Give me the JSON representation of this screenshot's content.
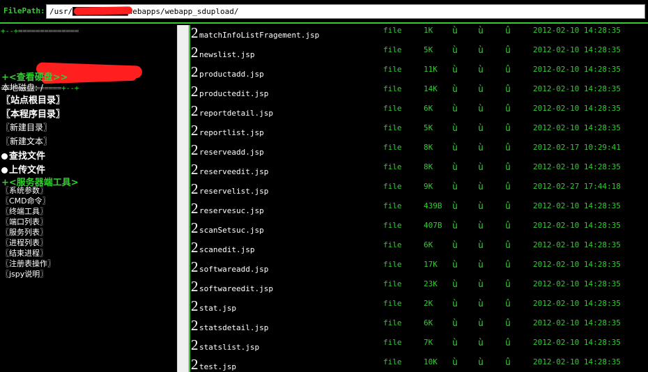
{
  "filepath": {
    "label": "FilePath:",
    "value": "/usr/████████████webapps/webapp_sdupload/"
  },
  "sidebar": {
    "sep_top": "+--+==============",
    "sep_bottom": "==============+--+",
    "disk_header": "+<查看硬盘>>",
    "local_disk": "本地磁盘: /",
    "site_root": "〖站点根目录〗",
    "program_dir": "〖本程序目录〗",
    "new_dir": "〖新建目录〗",
    "new_text": "〖新建文本〗",
    "find_file": "查找文件",
    "upload_file": "上传文件",
    "server_tools_header": "+<服务器端工具>",
    "tools": [
      "〖系统参数〗",
      "〖CMD命令〗",
      "〖终端工具〗",
      "〖端口列表〗",
      "〖服务列表〗",
      "〖进程列表〗",
      "〖结束进程〗",
      "〖注册表操作〗",
      "〖jspy说明〗"
    ]
  },
  "files": [
    {
      "name": "matchInfoListFragement.jsp",
      "type": "file",
      "size": "1K",
      "date": "2012-02-10 14:28:35"
    },
    {
      "name": "newslist.jsp",
      "type": "file",
      "size": "5K",
      "date": "2012-02-10 14:28:35"
    },
    {
      "name": "productadd.jsp",
      "type": "file",
      "size": "11K",
      "date": "2012-02-10 14:28:35"
    },
    {
      "name": "productedit.jsp",
      "type": "file",
      "size": "14K",
      "date": "2012-02-10 14:28:35"
    },
    {
      "name": "reportdetail.jsp",
      "type": "file",
      "size": "6K",
      "date": "2012-02-10 14:28:35"
    },
    {
      "name": "reportlist.jsp",
      "type": "file",
      "size": "5K",
      "date": "2012-02-10 14:28:35"
    },
    {
      "name": "reserveadd.jsp",
      "type": "file",
      "size": "8K",
      "date": "2012-02-17 10:29:41"
    },
    {
      "name": "reserveedit.jsp",
      "type": "file",
      "size": "8K",
      "date": "2012-02-10 14:28:35"
    },
    {
      "name": "reservelist.jsp",
      "type": "file",
      "size": "9K",
      "date": "2012-02-27 17:44:18"
    },
    {
      "name": "reservesuc.jsp",
      "type": "file",
      "size": "439B",
      "date": "2012-02-10 14:28:35"
    },
    {
      "name": "scanSetsuc.jsp",
      "type": "file",
      "size": "407B",
      "date": "2012-02-10 14:28:35"
    },
    {
      "name": "scanedit.jsp",
      "type": "file",
      "size": "6K",
      "date": "2012-02-10 14:28:35"
    },
    {
      "name": "softwareadd.jsp",
      "type": "file",
      "size": "17K",
      "date": "2012-02-10 14:28:35"
    },
    {
      "name": "softwareedit.jsp",
      "type": "file",
      "size": "23K",
      "date": "2012-02-10 14:28:35"
    },
    {
      "name": "stat.jsp",
      "type": "file",
      "size": "2K",
      "date": "2012-02-10 14:28:35"
    },
    {
      "name": "statsdetail.jsp",
      "type": "file",
      "size": "6K",
      "date": "2012-02-10 14:28:35"
    },
    {
      "name": "statslist.jsp",
      "type": "file",
      "size": "7K",
      "date": "2012-02-10 14:28:35"
    },
    {
      "name": "test.jsp",
      "type": "file",
      "size": "10K",
      "date": "2012-02-10 14:28:35"
    }
  ],
  "row_glyphs": {
    "marker": "2",
    "icon1": "ù",
    "icon2": "ù",
    "icon3": "û"
  },
  "colors": {
    "accent": "#33cc33",
    "background": "#000000",
    "redaction": "#ff1f1f"
  }
}
